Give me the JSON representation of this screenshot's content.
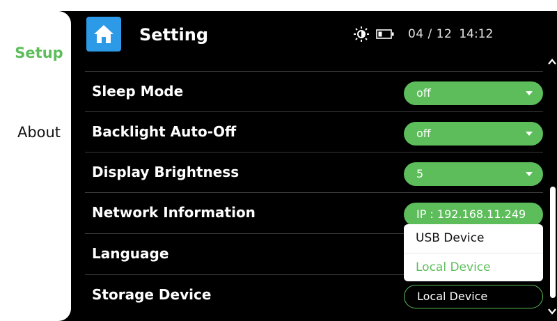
{
  "header": {
    "title": "Setting",
    "home_icon": "home-icon",
    "brightness_icon": "brightness-icon",
    "battery_icon": "battery-icon",
    "date": "04 / 12",
    "time": "14:12"
  },
  "sidebar": {
    "items": [
      {
        "label": "Setup",
        "active": true
      },
      {
        "label": "About",
        "active": false
      }
    ]
  },
  "settings": [
    {
      "label": "Sleep Mode",
      "value": "off",
      "control": "dropdown"
    },
    {
      "label": "Backlight Auto-Off",
      "value": "off",
      "control": "dropdown"
    },
    {
      "label": "Display Brightness",
      "value": "5",
      "control": "dropdown"
    },
    {
      "label": "Network Information",
      "value": "IP : 192.168.11.249",
      "control": "info"
    },
    {
      "label": "Language",
      "value": "",
      "control": "hidden"
    },
    {
      "label": "Storage Device",
      "value": "Local Device",
      "control": "dropdown-open"
    }
  ],
  "storage_dropdown": {
    "options": [
      "USB Device",
      "Local Device"
    ],
    "selected": "Local Device"
  },
  "colors": {
    "accent": "#5cbd5a",
    "home_button": "#2d9ae8",
    "background": "#000000"
  }
}
